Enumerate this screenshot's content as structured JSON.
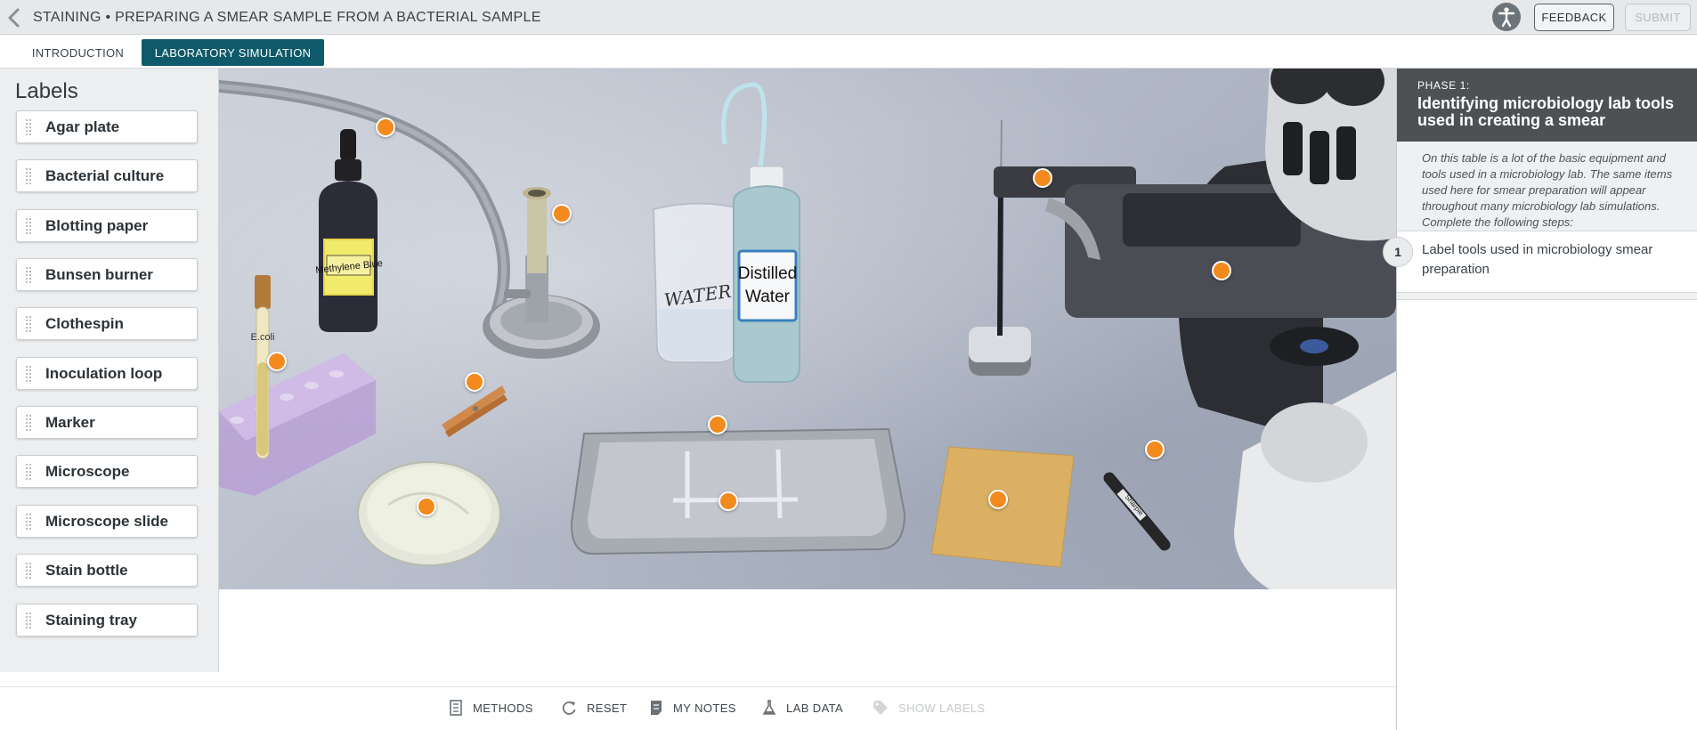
{
  "header": {
    "title": "STAINING • PREPARING A SMEAR SAMPLE FROM A BACTERIAL SAMPLE",
    "feedback_label": "FEEDBACK",
    "submit_label": "SUBMIT"
  },
  "tabs": [
    {
      "label": "INTRODUCTION",
      "active": false
    },
    {
      "label": "LABORATORY SIMULATION",
      "active": true
    }
  ],
  "labels_panel": {
    "heading": "Labels",
    "items": [
      {
        "label": "Agar plate"
      },
      {
        "label": "Bacterial culture"
      },
      {
        "label": "Blotting paper"
      },
      {
        "label": "Bunsen burner"
      },
      {
        "label": "Clothespin"
      },
      {
        "label": "Inoculation loop"
      },
      {
        "label": "Marker"
      },
      {
        "label": "Microscope"
      },
      {
        "label": "Microscope slide"
      },
      {
        "label": "Stain bottle"
      },
      {
        "label": "Staining tray"
      }
    ]
  },
  "scene": {
    "stain_bottle_label": "Methylene Blue",
    "beaker_label": "WATER",
    "wash_bottle_label_line1": "Distilled",
    "wash_bottle_label_line2": "Water",
    "tube_label": "E.coli",
    "marker_brand": "Sharpie"
  },
  "right_panel": {
    "phase_label": "PHASE 1:",
    "phase_title": "Identifying microbiology lab tools used in creating a smear",
    "description": "On this table is a lot of the basic equipment and tools used in a microbiology lab. The same items used here for smear preparation will appear throughout many microbiology lab simulations. Complete the following steps:",
    "steps": [
      {
        "number": "1",
        "text": "Label tools used in microbiology smear preparation"
      }
    ]
  },
  "toolbar": {
    "methods_label": "METHODS",
    "reset_label": "RESET",
    "notes_label": "MY NOTES",
    "lab_data_label": "LAB DATA",
    "show_labels_label": "SHOW LABELS"
  },
  "colors": {
    "accent_teal": "#0e5a6a",
    "marker_orange": "#f28a1e",
    "phase_header": "#4d5154"
  }
}
